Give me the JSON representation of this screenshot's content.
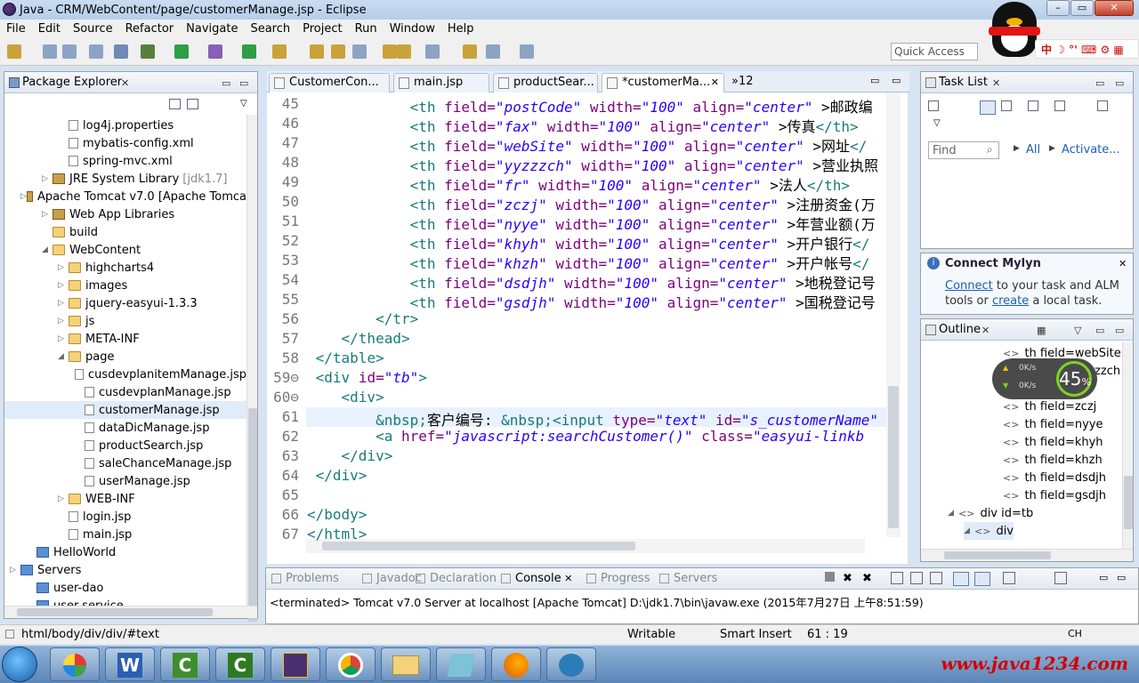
{
  "window": {
    "title": "Java - CRM/WebContent/page/customerManage.jsp - Eclipse"
  },
  "menu": [
    "File",
    "Edit",
    "Source",
    "Refactor",
    "Navigate",
    "Search",
    "Project",
    "Run",
    "Window",
    "Help"
  ],
  "quick_access": "Quick Access",
  "qq_strip": "中 ☽ °' ⌨ ⚙ ▦",
  "package_explorer": {
    "title": "Package Explorer",
    "items": [
      {
        "label": "log4j.properties",
        "type": "file",
        "indent": 3
      },
      {
        "label": "mybatis-config.xml",
        "type": "file",
        "indent": 3
      },
      {
        "label": "spring-mvc.xml",
        "type": "file",
        "indent": 3
      },
      {
        "label": "JRE System Library",
        "suffix": "[jdk1.7]",
        "type": "lib",
        "indent": 2,
        "arrow": "▷"
      },
      {
        "label": "Apache Tomcat v7.0 [Apache Tomca",
        "type": "lib",
        "indent": 2,
        "arrow": "▷"
      },
      {
        "label": "Web App Libraries",
        "type": "lib",
        "indent": 2,
        "arrow": "▷"
      },
      {
        "label": "build",
        "type": "folder",
        "indent": 2
      },
      {
        "label": "WebContent",
        "type": "folder",
        "indent": 2,
        "arrow": "◢"
      },
      {
        "label": "highcharts4",
        "type": "folder",
        "indent": 3,
        "arrow": "▷"
      },
      {
        "label": "images",
        "type": "folder",
        "indent": 3,
        "arrow": "▷"
      },
      {
        "label": "jquery-easyui-1.3.3",
        "type": "folder",
        "indent": 3,
        "arrow": "▷"
      },
      {
        "label": "js",
        "type": "folder",
        "indent": 3,
        "arrow": "▷"
      },
      {
        "label": "META-INF",
        "type": "folder",
        "indent": 3,
        "arrow": "▷"
      },
      {
        "label": "page",
        "type": "folder",
        "indent": 3,
        "arrow": "◢"
      },
      {
        "label": "cusdevplanitemManage.jsp",
        "type": "file",
        "indent": 4
      },
      {
        "label": "cusdevplanManage.jsp",
        "type": "file",
        "indent": 4
      },
      {
        "label": "customerManage.jsp",
        "type": "file",
        "indent": 4,
        "selected": true
      },
      {
        "label": "dataDicManage.jsp",
        "type": "file",
        "indent": 4
      },
      {
        "label": "productSearch.jsp",
        "type": "file",
        "indent": 4
      },
      {
        "label": "saleChanceManage.jsp",
        "type": "file",
        "indent": 4
      },
      {
        "label": "userManage.jsp",
        "type": "file",
        "indent": 4
      },
      {
        "label": "WEB-INF",
        "type": "folder",
        "indent": 3,
        "arrow": "▷"
      },
      {
        "label": "login.jsp",
        "type": "file",
        "indent": 3
      },
      {
        "label": "main.jsp",
        "type": "file",
        "indent": 3
      },
      {
        "label": "HelloWorld",
        "type": "proj",
        "indent": 1
      },
      {
        "label": "Servers",
        "type": "proj",
        "indent": 0,
        "arrow": "▷"
      },
      {
        "label": "user-dao",
        "type": "proj",
        "indent": 1
      },
      {
        "label": "user-service",
        "type": "proj",
        "indent": 1
      }
    ]
  },
  "editor_tabs": [
    {
      "label": "CustomerCon...",
      "active": false
    },
    {
      "label": "main.jsp",
      "active": false
    },
    {
      "label": "productSear...",
      "active": false
    },
    {
      "label": "*customerMa...",
      "active": true
    },
    {
      "label": "»12",
      "active": false,
      "overflow": true
    }
  ],
  "code": {
    "lines": [
      {
        "n": "45",
        "segs": [
          [
            "p",
            "            "
          ],
          [
            "t",
            "<th "
          ],
          [
            "a",
            "field="
          ],
          [
            "v",
            "\"postCode\""
          ],
          [
            "a",
            " width="
          ],
          [
            "v",
            "\"100\""
          ],
          [
            "a",
            " align="
          ],
          [
            "v",
            "\"center\""
          ],
          [
            "p",
            " >邮政编"
          ]
        ]
      },
      {
        "n": "46",
        "segs": [
          [
            "p",
            "            "
          ],
          [
            "t",
            "<th "
          ],
          [
            "a",
            "field="
          ],
          [
            "v",
            "\"fax\""
          ],
          [
            "a",
            " width="
          ],
          [
            "v",
            "\"100\""
          ],
          [
            "a",
            " align="
          ],
          [
            "v",
            "\"center\""
          ],
          [
            "p",
            " >传真"
          ],
          [
            "t",
            "</th>"
          ]
        ]
      },
      {
        "n": "47",
        "segs": [
          [
            "p",
            "            "
          ],
          [
            "t",
            "<th "
          ],
          [
            "a",
            "field="
          ],
          [
            "v",
            "\"webSite\""
          ],
          [
            "a",
            " width="
          ],
          [
            "v",
            "\"100\""
          ],
          [
            "a",
            " align="
          ],
          [
            "v",
            "\"center\""
          ],
          [
            "p",
            " >网址"
          ],
          [
            "t",
            "</"
          ]
        ]
      },
      {
        "n": "48",
        "segs": [
          [
            "p",
            "            "
          ],
          [
            "t",
            "<th "
          ],
          [
            "a",
            "field="
          ],
          [
            "v",
            "\"yyzzzch\""
          ],
          [
            "a",
            " width="
          ],
          [
            "v",
            "\"100\""
          ],
          [
            "a",
            " align="
          ],
          [
            "v",
            "\"center\""
          ],
          [
            "p",
            " >营业执照"
          ]
        ]
      },
      {
        "n": "49",
        "segs": [
          [
            "p",
            "            "
          ],
          [
            "t",
            "<th "
          ],
          [
            "a",
            "field="
          ],
          [
            "v",
            "\"fr\""
          ],
          [
            "a",
            " width="
          ],
          [
            "v",
            "\"100\""
          ],
          [
            "a",
            " align="
          ],
          [
            "v",
            "\"center\""
          ],
          [
            "p",
            " >法人"
          ],
          [
            "t",
            "</th>"
          ]
        ]
      },
      {
        "n": "50",
        "segs": [
          [
            "p",
            "            "
          ],
          [
            "t",
            "<th "
          ],
          [
            "a",
            "field="
          ],
          [
            "v",
            "\"zczj\""
          ],
          [
            "a",
            " width="
          ],
          [
            "v",
            "\"100\""
          ],
          [
            "a",
            " align="
          ],
          [
            "v",
            "\"center\""
          ],
          [
            "p",
            " >注册资金(万"
          ]
        ]
      },
      {
        "n": "51",
        "segs": [
          [
            "p",
            "            "
          ],
          [
            "t",
            "<th "
          ],
          [
            "a",
            "field="
          ],
          [
            "v",
            "\"nyye\""
          ],
          [
            "a",
            " width="
          ],
          [
            "v",
            "\"100\""
          ],
          [
            "a",
            " align="
          ],
          [
            "v",
            "\"center\""
          ],
          [
            "p",
            " >年营业额(万"
          ]
        ]
      },
      {
        "n": "52",
        "segs": [
          [
            "p",
            "            "
          ],
          [
            "t",
            "<th "
          ],
          [
            "a",
            "field="
          ],
          [
            "v",
            "\"khyh\""
          ],
          [
            "a",
            " width="
          ],
          [
            "v",
            "\"100\""
          ],
          [
            "a",
            " align="
          ],
          [
            "v",
            "\"center\""
          ],
          [
            "p",
            " >开户银行"
          ],
          [
            "t",
            "</"
          ]
        ]
      },
      {
        "n": "53",
        "segs": [
          [
            "p",
            "            "
          ],
          [
            "t",
            "<th "
          ],
          [
            "a",
            "field="
          ],
          [
            "v",
            "\"khzh\""
          ],
          [
            "a",
            " width="
          ],
          [
            "v",
            "\"100\""
          ],
          [
            "a",
            " align="
          ],
          [
            "v",
            "\"center\""
          ],
          [
            "p",
            " >开户帐号"
          ],
          [
            "t",
            "</"
          ]
        ]
      },
      {
        "n": "54",
        "segs": [
          [
            "p",
            "            "
          ],
          [
            "t",
            "<th "
          ],
          [
            "a",
            "field="
          ],
          [
            "v",
            "\"dsdjh\""
          ],
          [
            "a",
            " width="
          ],
          [
            "v",
            "\"100\""
          ],
          [
            "a",
            " align="
          ],
          [
            "v",
            "\"center\""
          ],
          [
            "p",
            " >地税登记号"
          ]
        ]
      },
      {
        "n": "55",
        "segs": [
          [
            "p",
            "            "
          ],
          [
            "t",
            "<th "
          ],
          [
            "a",
            "field="
          ],
          [
            "v",
            "\"gsdjh\""
          ],
          [
            "a",
            " width="
          ],
          [
            "v",
            "\"100\""
          ],
          [
            "a",
            " align="
          ],
          [
            "v",
            "\"center\""
          ],
          [
            "p",
            " >国税登记号"
          ]
        ]
      },
      {
        "n": "56",
        "segs": [
          [
            "p",
            "        "
          ],
          [
            "t",
            "</tr>"
          ]
        ]
      },
      {
        "n": "57",
        "segs": [
          [
            "p",
            "    "
          ],
          [
            "t",
            "</thead>"
          ]
        ]
      },
      {
        "n": "58",
        "segs": [
          [
            "p",
            " "
          ],
          [
            "t",
            "</table>"
          ]
        ]
      },
      {
        "n": "59⊖",
        "segs": [
          [
            "p",
            " "
          ],
          [
            "t",
            "<div "
          ],
          [
            "a",
            "id="
          ],
          [
            "v",
            "\"tb\""
          ],
          [
            "t",
            ">"
          ]
        ]
      },
      {
        "n": "60⊖",
        "segs": [
          [
            "p",
            "    "
          ],
          [
            "t",
            "<div>"
          ]
        ]
      },
      {
        "n": "61",
        "current": true,
        "segs": [
          [
            "p",
            "        "
          ],
          [
            "g",
            "&nbsp;"
          ],
          [
            "p",
            "客户编号: "
          ],
          [
            "g",
            "&nbsp;"
          ],
          [
            "t",
            "<input "
          ],
          [
            "a",
            "type="
          ],
          [
            "v",
            "\"text\""
          ],
          [
            "a",
            " id="
          ],
          [
            "v",
            "\"s_customerName\""
          ]
        ]
      },
      {
        "n": "62",
        "segs": [
          [
            "p",
            "        "
          ],
          [
            "t",
            "<a "
          ],
          [
            "a",
            "href="
          ],
          [
            "v",
            "\"javascript:searchCustomer()\""
          ],
          [
            "a",
            " class="
          ],
          [
            "v",
            "\"easyui-linkb"
          ]
        ]
      },
      {
        "n": "63",
        "segs": [
          [
            "p",
            "    "
          ],
          [
            "t",
            "</div>"
          ]
        ]
      },
      {
        "n": "64",
        "segs": [
          [
            "p",
            " "
          ],
          [
            "t",
            "</div>"
          ]
        ]
      },
      {
        "n": "65",
        "segs": [
          [
            "p",
            ""
          ]
        ]
      },
      {
        "n": "66",
        "segs": [
          [
            "t",
            "</body>"
          ]
        ]
      },
      {
        "n": "67",
        "segs": [
          [
            "t",
            "</html>"
          ]
        ]
      }
    ]
  },
  "task_list": {
    "title": "Task List",
    "find_placeholder": "Find",
    "all": "All",
    "activate": "Activate..."
  },
  "mylyn": {
    "title": "Connect Mylyn",
    "text_a": "Connect",
    "text_b": " to your task and ALM tools or ",
    "text_c": "create",
    "text_d": " a local task."
  },
  "outline": {
    "title": "Outline",
    "items": [
      {
        "label": "th field=webSite",
        "indent": 1
      },
      {
        "label": "th field=yyzzzch",
        "indent": 1
      },
      {
        "label": "th field=fr",
        "indent": 1
      },
      {
        "label": "th field=zczj",
        "indent": 1
      },
      {
        "label": "th field=nyye",
        "indent": 1
      },
      {
        "label": "th field=khyh",
        "indent": 1
      },
      {
        "label": "th field=khzh",
        "indent": 1
      },
      {
        "label": "th field=dsdjh",
        "indent": 1
      },
      {
        "label": "th field=gsdjh",
        "indent": 1
      },
      {
        "label": "div id=tb",
        "indent": 0,
        "arrow": "◢"
      },
      {
        "label": "div",
        "indent": 0.5,
        "arrow": "◢",
        "selected": true
      }
    ]
  },
  "speed_widget": {
    "percent": "45",
    "unit": "%",
    "up": "0K/s",
    "down": "0K/s"
  },
  "console": {
    "tabs": [
      {
        "label": "Problems",
        "active": false
      },
      {
        "label": "Javadoc",
        "active": false
      },
      {
        "label": "Declaration",
        "active": false
      },
      {
        "label": "Console",
        "active": true
      },
      {
        "label": "Progress",
        "active": false
      },
      {
        "label": "Servers",
        "active": false
      }
    ],
    "line": "<terminated> Tomcat v7.0 Server at localhost [Apache Tomcat] D:\\jdk1.7\\bin\\javaw.exe (2015年7月27日 上午8:51:59)"
  },
  "status": {
    "path": "html/body/div/div/#text",
    "mode": "Writable",
    "insert": "Smart Insert",
    "pos": "61 : 19",
    "ime": "CH"
  },
  "watermark": "www.java1234.com"
}
